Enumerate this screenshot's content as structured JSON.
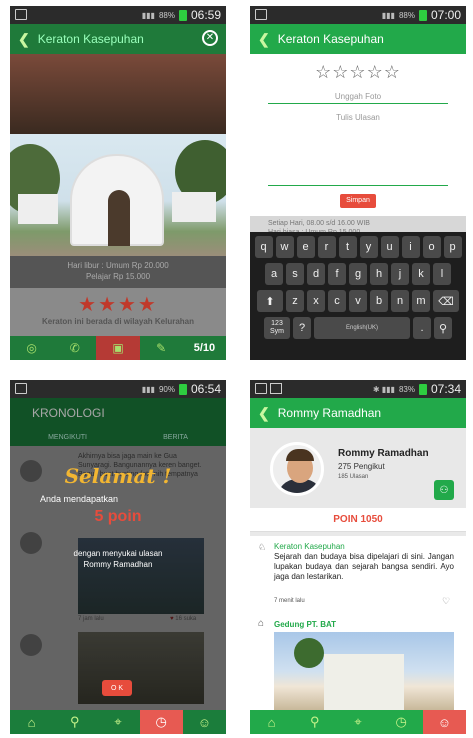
{
  "status": {
    "p1_time": "06:59",
    "p1_batt": "88%",
    "p2_time": "07:00",
    "p2_batt": "88%",
    "p3_time": "06:54",
    "p3_batt": "90%",
    "p4_time": "07:34",
    "p4_batt": "83%"
  },
  "s1": {
    "title": "Keraton Kasepuhan",
    "info_a": "Hari libur : Umum Rp 20.000",
    "info_b": "Pelajar Rp 15.000",
    "stars": "★★★★",
    "desc": "Keraton ini berada di wilayah Kelurahan",
    "counter": "5/10"
  },
  "s2": {
    "title": "Keraton Kasepuhan",
    "stars": "☆☆☆☆☆",
    "upload": "Unggah Foto",
    "review_placeholder": "Tulis Ulasan",
    "save": "Simpan",
    "behind_a": "Setiap Hari, 08.00 s/d 16.00 WIB",
    "behind_b": "Hari biasa : Umum Rp 15.000",
    "space": "English(UK)",
    "sym": "123 Sym"
  },
  "s3": {
    "title": "KRONOLOGI",
    "tab_a": "MENGIKUTI",
    "tab_b": "BERITA",
    "feed_text": "Akhirnya bisa jaga main ke Gua Sunyaragi. Bangunannya keren banget. Bagus buat hunting foto nih tempatnya",
    "feed_time": "7 jam lalu",
    "feed_likes": "16 suka",
    "popup_title": "Selamat !",
    "popup_line": "Anda mendapatkan",
    "popup_poin": "5 poin",
    "popup_line2": "dengan menyukai ulasan",
    "popup_name": "Rommy Ramadhan",
    "ok": "O K"
  },
  "s4": {
    "title": "Rommy Ramadhan",
    "name": "Rommy Ramadhan",
    "followers": "275 Pengikut",
    "reviews": "185 Ulasan",
    "poin": "POIN 1050",
    "place": "Keraton Kasepuhan",
    "review": "Sejarah dan budaya bisa dipelajari di sini. Jangan lupakan budaya dan sejarah bangsa sendiri. Ayo jaga dan lestarikan.",
    "rtime": "7 menit lalu",
    "place2": "Gedung PT. BAT"
  },
  "keyboard": {
    "row1": [
      "q",
      "w",
      "e",
      "r",
      "t",
      "y",
      "u",
      "i",
      "o",
      "p"
    ],
    "row2": [
      "a",
      "s",
      "d",
      "f",
      "g",
      "h",
      "j",
      "k",
      "l"
    ],
    "row3": [
      "z",
      "x",
      "c",
      "v",
      "b",
      "n",
      "m"
    ]
  }
}
